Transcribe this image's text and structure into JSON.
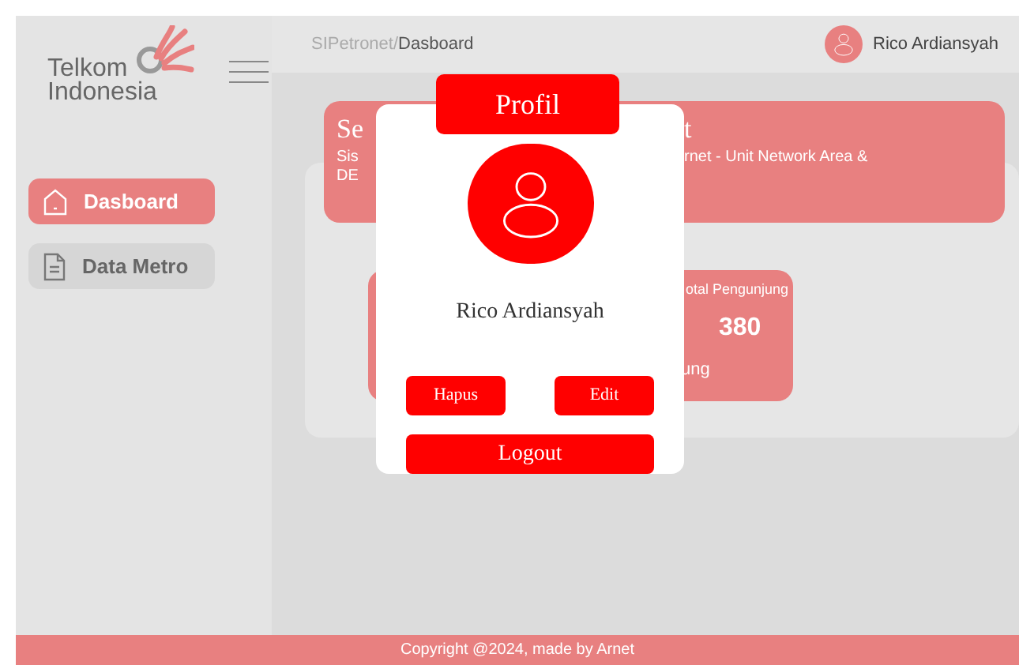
{
  "sidebar": {
    "logo": {
      "line_1": "Telkom",
      "line_2": "Indonesia"
    },
    "items": [
      {
        "label": "Dasboard",
        "kind": "home",
        "selected": true
      },
      {
        "label": "Data Metro",
        "kind": "document",
        "selected": false
      }
    ]
  },
  "header": {
    "breadcrumb": {
      "parent": "SIPetronet/",
      "current": "Dasboard"
    },
    "user": "Rico Ardiansyah"
  },
  "banner": {
    "title_start": "Se",
    "title_end": "t",
    "text_start_1": "Sis",
    "text_start_2": "DE",
    "text_end": "rnet - Unit Network Area &"
  },
  "stat_card": {
    "label": "otal Pengunjung",
    "value": "380",
    "caption": "ung"
  },
  "modal": {
    "title": "Profil",
    "name": "Rico Ardiansyah",
    "buttons": [
      "Hapus",
      "Edit"
    ],
    "logout": "Logout"
  },
  "footer": "Copyright @2024, made by Arnet"
}
